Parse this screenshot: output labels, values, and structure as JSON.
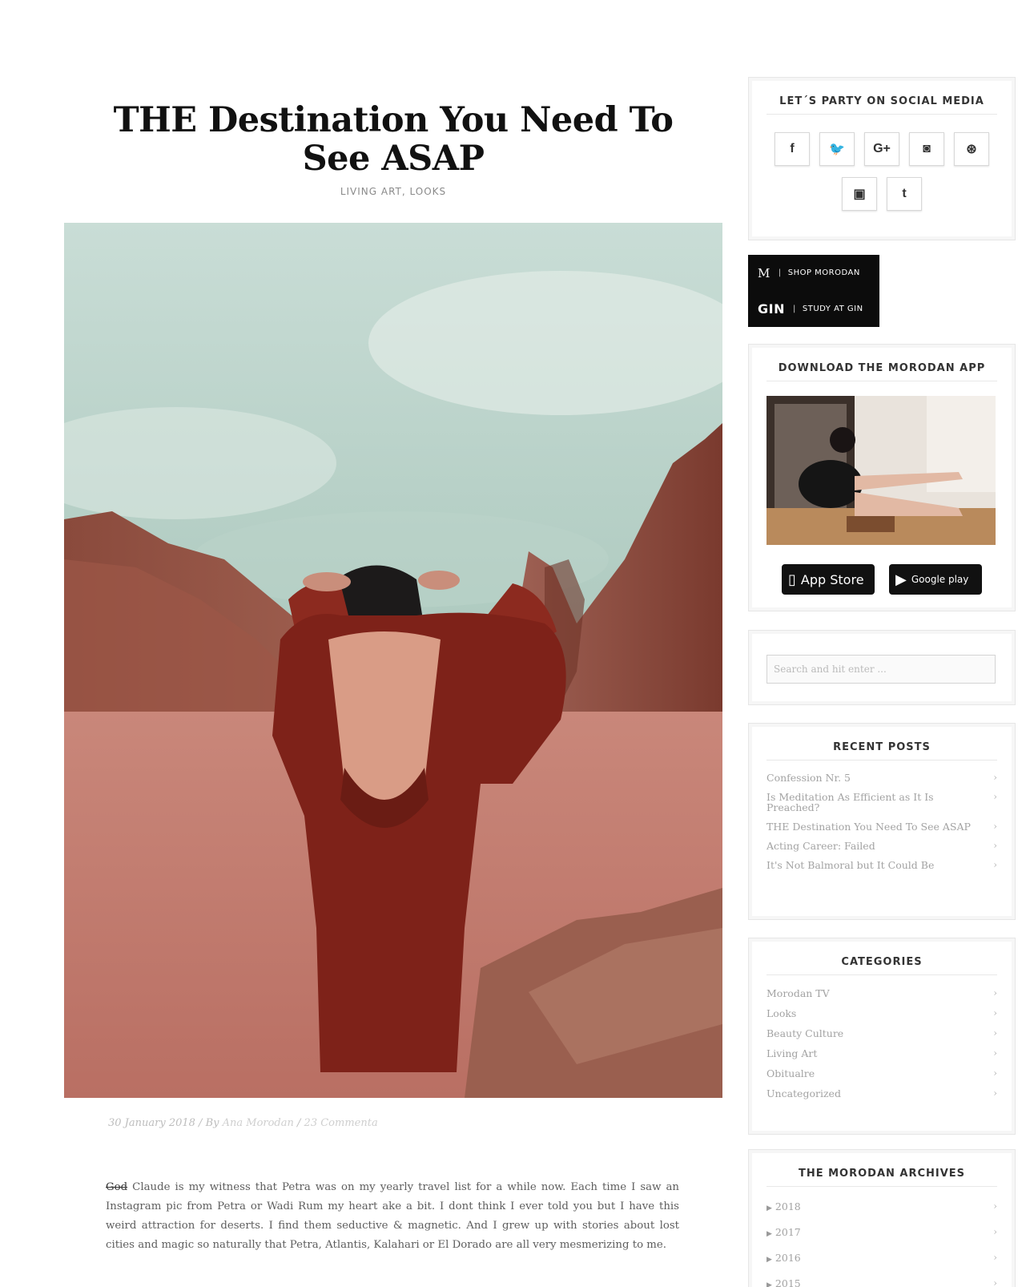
{
  "post": {
    "title": "THE Destination You Need To See ASAP",
    "categories": [
      "LIVING ART",
      "LOOKS"
    ],
    "category_separator": ", ",
    "meta": {
      "date": "30 January 2018",
      "by_prefix": " / By ",
      "author": "Ana Morodan",
      "comments_prefix": " / ",
      "comments": "23 Commenta"
    },
    "body_struck": "God",
    "body": " Claude is my witness that Petra was on my yearly travel list for a while now. Each time I saw an Instagram pic from Petra or Wadi Rum my heart ake a bit. I dont think I ever told you but I have this weird attraction for deserts. I find them seductive & magnetic. And I grew up with stories about lost cities and magic so naturally that Petra, Atlantis, Kalahari or El Dorado are all very mesmerizing to me."
  },
  "sidebar": {
    "social": {
      "title": "LET´S PARTY ON SOCIAL MEDIA",
      "buttons": [
        {
          "icon": "facebook-icon",
          "glyph": "f"
        },
        {
          "icon": "twitter-icon",
          "glyph": "🐦"
        },
        {
          "icon": "google-plus-icon",
          "glyph": "G+"
        },
        {
          "icon": "instagram-icon",
          "glyph": "◙"
        },
        {
          "icon": "pinterest-icon",
          "glyph": "⊛"
        },
        {
          "icon": "youtube-icon",
          "glyph": "▣"
        },
        {
          "icon": "tumblr-icon",
          "glyph": "t"
        }
      ]
    },
    "banners": [
      {
        "mark": "M",
        "label": "SHOP MORODAN"
      },
      {
        "mark": "GIN",
        "label": "STUDY AT GIN"
      }
    ],
    "app": {
      "title": "DOWNLOAD THE MORODAN APP",
      "app_store": "App Store",
      "google_play": "Google play"
    },
    "search": {
      "placeholder": "Search and hit enter ..."
    },
    "recent": {
      "title": "RECENT POSTS",
      "items": [
        "Confession Nr. 5",
        "Is Meditation As Efficient as It Is Preached?",
        "THE Destination You Need To See ASAP",
        "Acting Career: Failed",
        "It's Not Balmoral but It Could Be"
      ]
    },
    "categories": {
      "title": "CATEGORIES",
      "items": [
        "Morodan TV",
        "Looks",
        "Beauty Culture",
        "Living Art",
        "Obitualre",
        "Uncategorized"
      ]
    },
    "archives": {
      "title": "THE MORODAN ARCHIVES",
      "items": [
        "2018",
        "2017",
        "2016",
        "2015"
      ]
    },
    "chevron": "›",
    "archive_marker": "▶"
  }
}
